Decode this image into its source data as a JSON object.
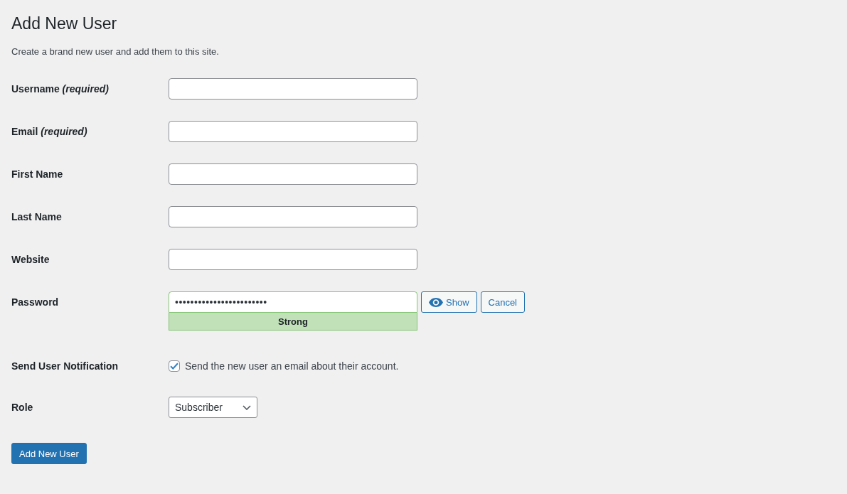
{
  "page": {
    "title": "Add New User",
    "description": "Create a brand new user and add them to this site."
  },
  "fields": [
    {
      "kind": "text",
      "label": "Username *(required)*"
    },
    {
      "kind": "text",
      "label": "Email *(required)*"
    },
    {
      "kind": "text",
      "label": "First Name"
    },
    {
      "kind": "text",
      "label": "Last Name"
    },
    {
      "kind": "text",
      "label": "Website"
    },
    {
      "kind": "password",
      "label": "Password",
      "value": "••••••••••••••••••••••••",
      "strength": {
        "kind": "strong",
        "label": "Strong"
      },
      "buttons": [
        {
          "kind": "show",
          "label": "Show"
        },
        {
          "kind": "cancel",
          "label": "Cancel"
        }
      ]
    },
    {
      "kind": "checkbox",
      "label": "Send User Notification",
      "text": "Send the new user an email about their account.",
      "checked": true
    },
    {
      "kind": "select",
      "label": "Role",
      "value": "Subscriber"
    }
  ],
  "submit": {
    "label": "Add New User"
  }
}
